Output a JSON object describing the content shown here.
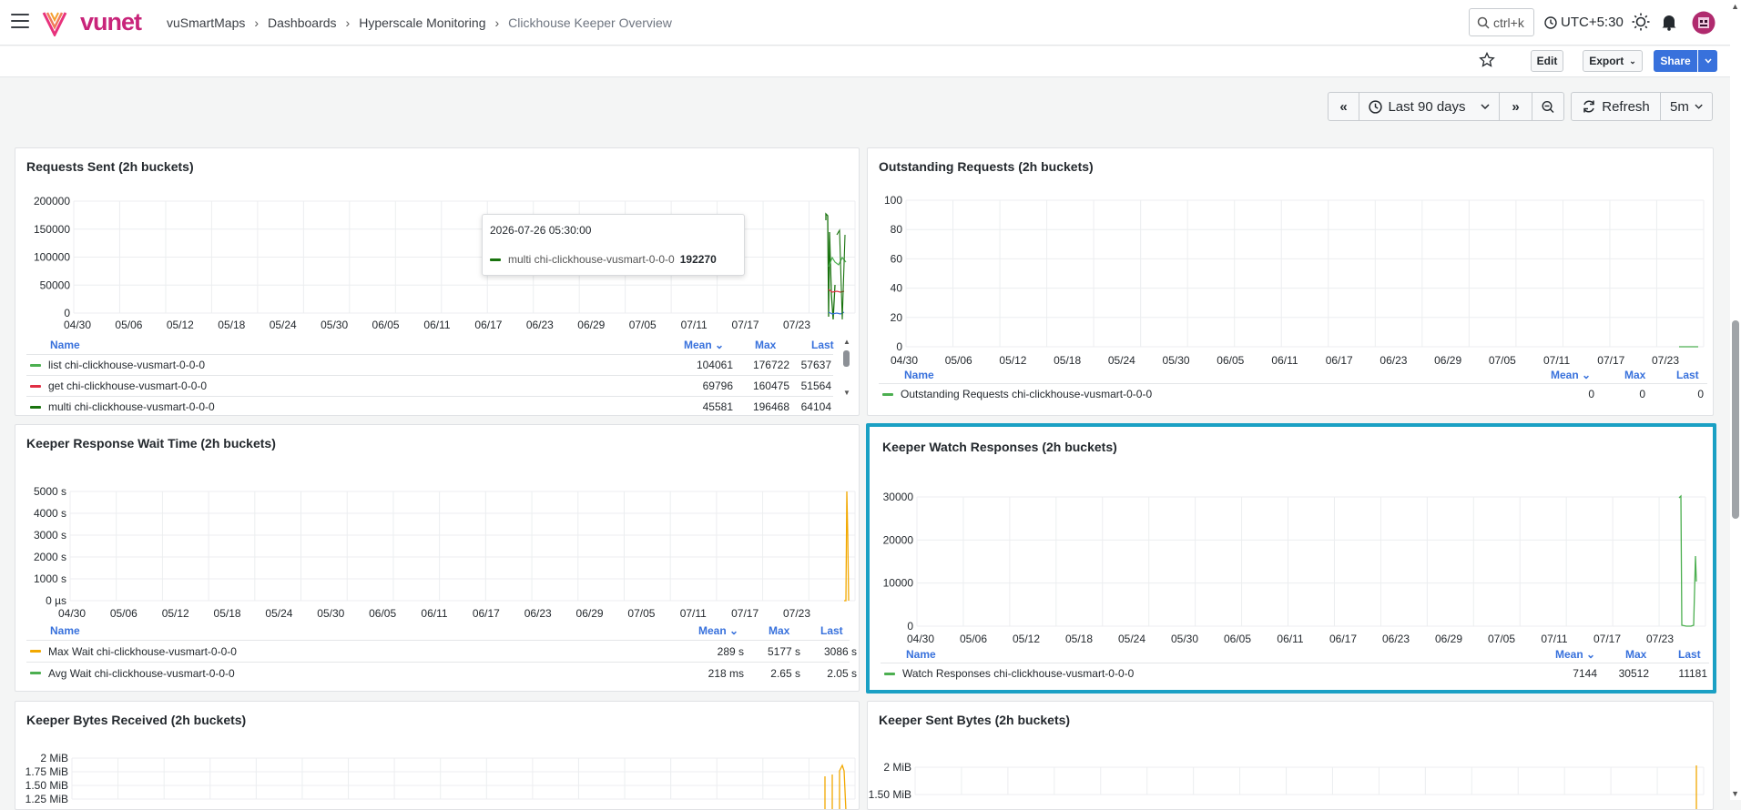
{
  "topbar": {
    "brand": "vunet",
    "breadcrumbs": [
      "vuSmartMaps",
      "Dashboards",
      "Hyperscale Monitoring",
      "Clickhouse Keeper Overview"
    ],
    "search_shortcut": "ctrl+k",
    "timezone": "UTC+5:30"
  },
  "toolbar": {
    "edit": "Edit",
    "export": "Export",
    "share": "Share"
  },
  "timepicker": {
    "range": "Last 90 days",
    "refresh": "Refresh",
    "interval": "5m"
  },
  "x_ticks": [
    "04/30",
    "05/06",
    "05/12",
    "05/18",
    "05/24",
    "05/30",
    "06/05",
    "06/11",
    "06/17",
    "06/23",
    "06/29",
    "07/05",
    "07/11",
    "07/17",
    "07/23"
  ],
  "x_ticks_b": [
    "04/30",
    "05/06",
    "05/12",
    "05/18",
    "05/24",
    "05/30",
    "06/05",
    "06/11",
    "06/17",
    "06/23",
    "06/29",
    "07/05",
    "07/11",
    "07/17",
    "07/23"
  ],
  "legend_headers": {
    "name": "Name",
    "mean": "Mean",
    "max": "Max",
    "last": "Last"
  },
  "panels": {
    "requests_sent": {
      "title": "Requests Sent (2h buckets)",
      "y_ticks": [
        "200000",
        "150000",
        "100000",
        "50000",
        "0"
      ],
      "rows": [
        {
          "name": "list chi-clickhouse-vusmart-0-0-0",
          "mean": "104061",
          "max": "176722",
          "last": "57637",
          "color": "#4caf50"
        },
        {
          "name": "get chi-clickhouse-vusmart-0-0-0",
          "mean": "69796",
          "max": "160475",
          "last": "51564",
          "color": "#e02f44"
        },
        {
          "name": "multi chi-clickhouse-vusmart-0-0-0",
          "mean": "45581",
          "max": "196468",
          "last": "64104",
          "color": "#19730e"
        }
      ],
      "tooltip": {
        "time": "2026-07-26 05:30:00",
        "series": "multi chi-clickhouse-vusmart-0-0-0",
        "value": "192270"
      }
    },
    "outstanding": {
      "title": "Outstanding Requests (2h buckets)",
      "y_ticks": [
        "100",
        "80",
        "60",
        "40",
        "20",
        "0"
      ],
      "rows": [
        {
          "name": "Outstanding Requests chi-clickhouse-vusmart-0-0-0",
          "mean": "0",
          "max": "0",
          "last": "0",
          "color": "#4caf50"
        }
      ]
    },
    "wait_time": {
      "title": "Keeper Response Wait Time (2h buckets)",
      "y_ticks": [
        "5000 s",
        "4000 s",
        "3000 s",
        "2000 s",
        "1000 s",
        "0 µs"
      ],
      "rows": [
        {
          "name": "Max Wait chi-clickhouse-vusmart-0-0-0",
          "mean": "289 s",
          "max": "5177 s",
          "last": "3086 s",
          "color": "#f2a800"
        },
        {
          "name": "Avg Wait chi-clickhouse-vusmart-0-0-0",
          "mean": "218 ms",
          "max": "2.65 s",
          "last": "2.05 s",
          "color": "#4caf50"
        }
      ]
    },
    "watch": {
      "title": "Keeper Watch Responses (2h buckets)",
      "y_ticks": [
        "30000",
        "20000",
        "10000",
        "0"
      ],
      "rows": [
        {
          "name": "Watch Responses chi-clickhouse-vusmart-0-0-0",
          "mean": "7144",
          "max": "30512",
          "last": "11181",
          "color": "#4caf50"
        }
      ]
    },
    "bytes_recv": {
      "title": "Keeper Bytes Received (2h buckets)",
      "y_ticks": [
        "2 MiB",
        "1.75 MiB",
        "1.50 MiB",
        "1.25 MiB"
      ]
    },
    "bytes_sent": {
      "title": "Keeper Sent Bytes (2h buckets)",
      "y_ticks": [
        "2 MiB",
        "1.50 MiB"
      ]
    }
  },
  "colors": {
    "accent": "#3871dc",
    "focus": "#1aa0c4",
    "green": "#4caf50",
    "red": "#e02f44",
    "yellow": "#f2a800",
    "dark_green": "#19730e"
  }
}
